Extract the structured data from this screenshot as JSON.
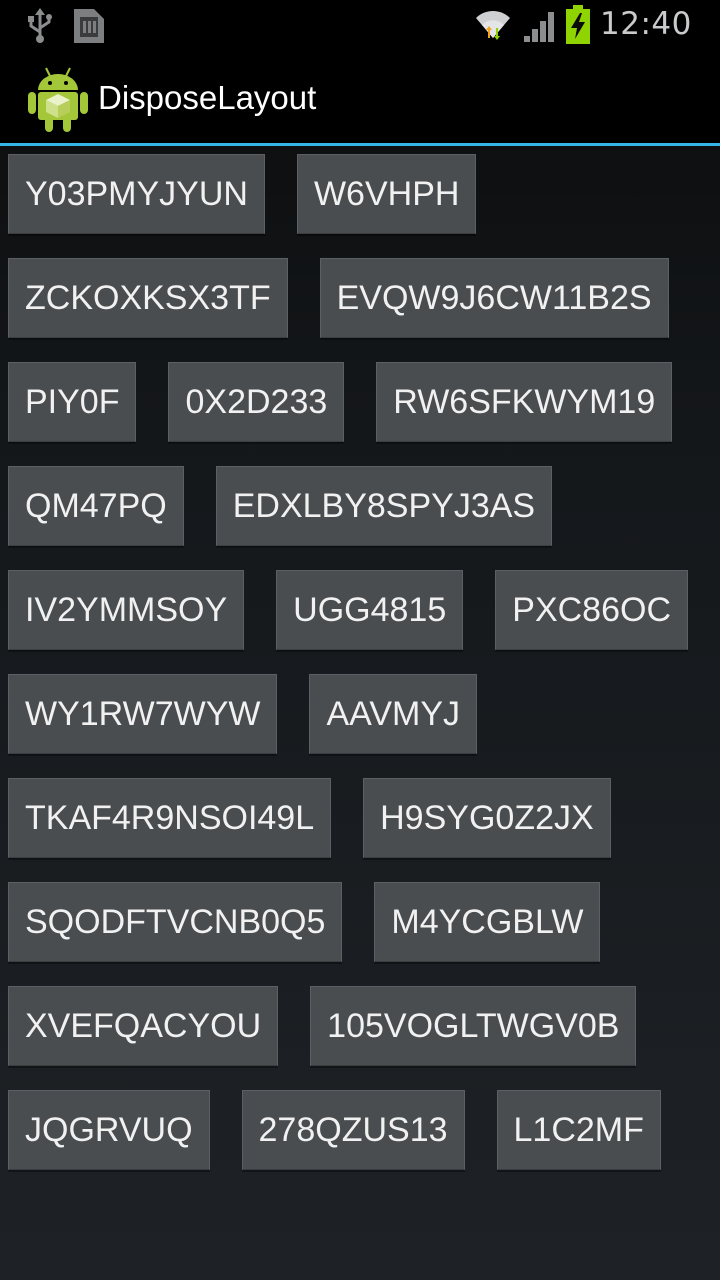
{
  "status_bar": {
    "time": "12:40",
    "battery_color": "#8fd400",
    "wifi_color": "#cfd0d1",
    "icons": [
      "usb-icon",
      "sd-card-icon",
      "wifi-icon",
      "signal-icon",
      "battery-charging-icon"
    ]
  },
  "action_bar": {
    "app_icon": "android-icon",
    "title": "DisposeLayout",
    "accent_color": "#33b5e5"
  },
  "rows": [
    {
      "buttons": [
        "Y03PMYJYUN",
        "W6VHPH"
      ]
    },
    {
      "buttons": [
        "ZCKOXKSX3TF",
        "EVQW9J6CW11B2S"
      ]
    },
    {
      "buttons": [
        "PIY0F",
        "0X2D233",
        "RW6SFKWYM19"
      ]
    },
    {
      "buttons": [
        "QM47PQ",
        "EDXLBY8SPYJ3AS"
      ]
    },
    {
      "buttons": [
        "IV2YMMSOY",
        "UGG4815",
        "PXC86OC"
      ]
    },
    {
      "buttons": [
        "WY1RW7WYW",
        "AAVMYJ"
      ]
    },
    {
      "buttons": [
        "TKAF4R9NSOI49L",
        "H9SYG0Z2JX"
      ]
    },
    {
      "buttons": [
        "SQODFTVCNB0Q5",
        "M4YCGBLW"
      ]
    },
    {
      "buttons": [
        "XVEFQACYOU",
        "105VOGLTWGV0B"
      ]
    },
    {
      "buttons": [
        "JQGRVUQ",
        "278QZUS13",
        "L1C2MF"
      ]
    }
  ]
}
